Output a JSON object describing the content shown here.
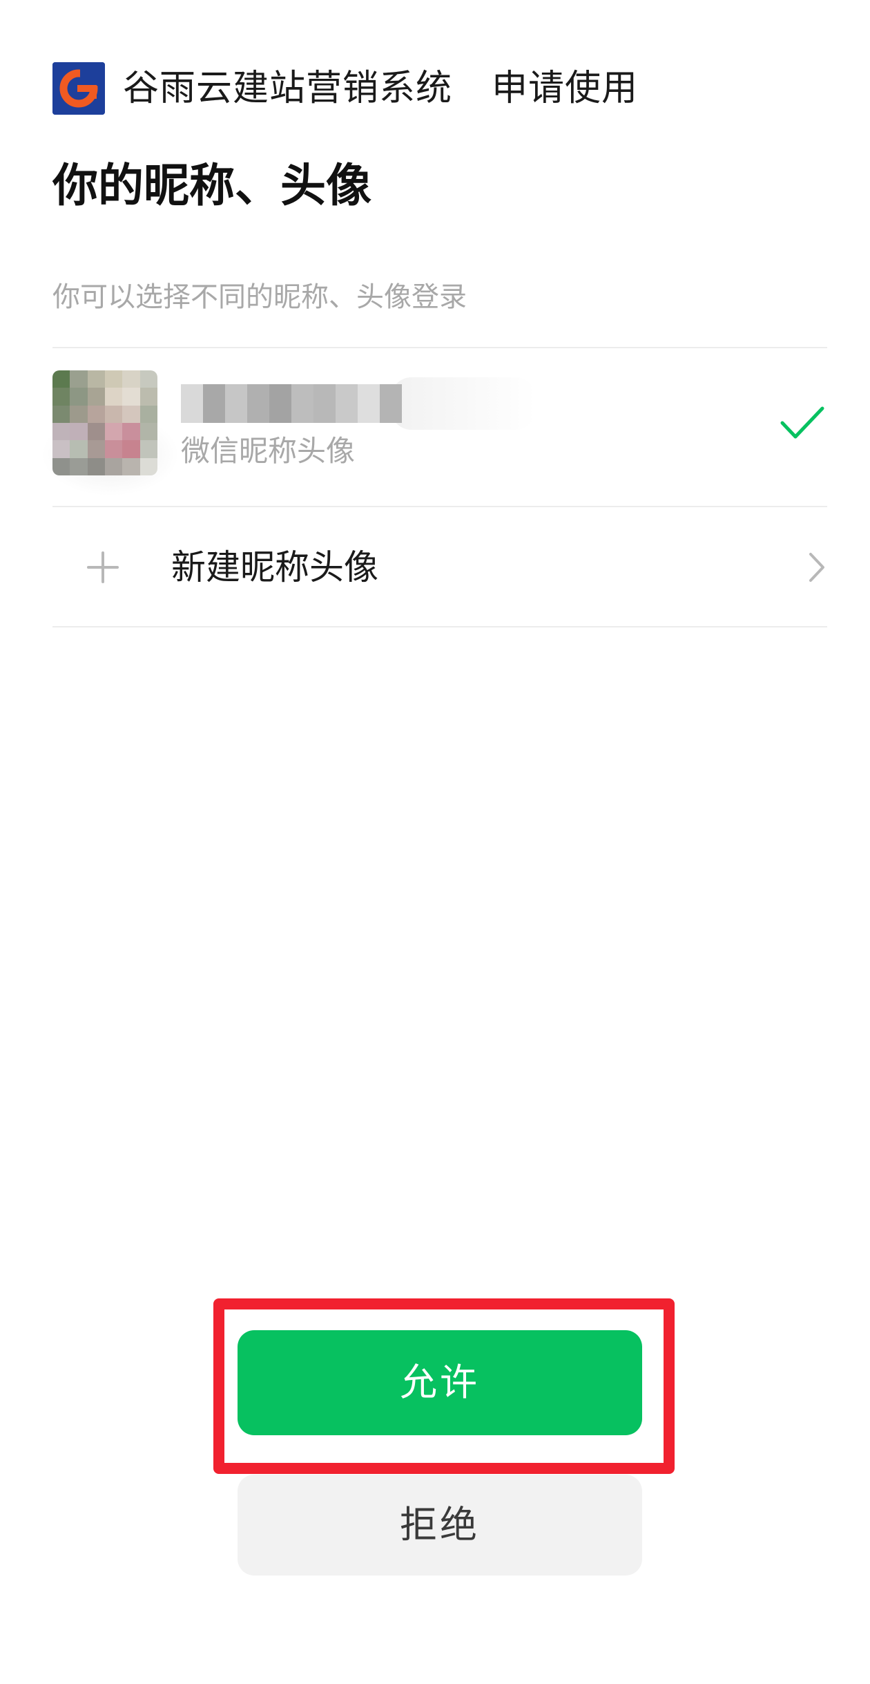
{
  "header": {
    "app_name": "谷雨云建站营销系统",
    "request_text": "申请使用",
    "logo_icon": "gu-yu-logo-icon",
    "logo_colors": {
      "background": "#1d3f9b",
      "mark": "#f05a22"
    }
  },
  "title": "你的昵称、头像",
  "subtitle": "你可以选择不同的昵称、头像登录",
  "options": {
    "current_profile": {
      "caption": "微信昵称头像",
      "avatar_icon": "blurred-avatar",
      "selected": true,
      "selected_icon": "check-icon"
    },
    "new_profile": {
      "label": "新建昵称头像",
      "leading_icon": "plus-icon",
      "trailing_icon": "chevron-right-icon"
    }
  },
  "actions": {
    "allow_label": "允许",
    "deny_label": "拒绝"
  },
  "colors": {
    "accent_green": "#07c160",
    "highlight_red": "#f1212f",
    "muted_text": "#a8a8a8",
    "deny_bg": "#f2f2f2"
  }
}
